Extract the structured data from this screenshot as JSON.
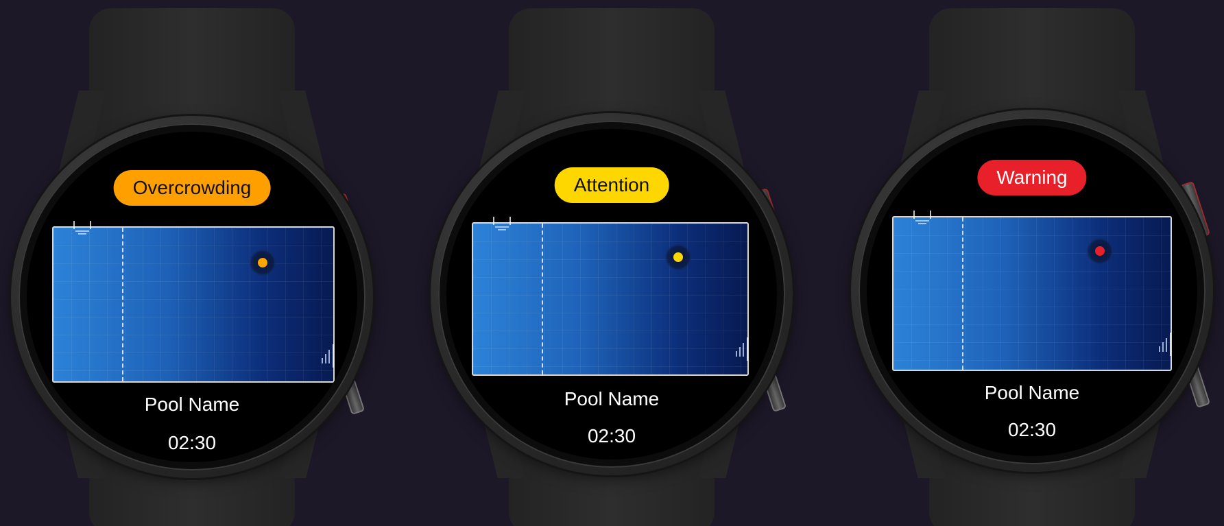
{
  "watches": [
    {
      "status_label": "Overcrowding",
      "status_color": "#ff9f00",
      "status_text_color": "#111111",
      "marker_color": "#ffa500",
      "pool_name": "Pool Name",
      "time": "02:30"
    },
    {
      "status_label": "Attention",
      "status_color": "#ffd700",
      "status_text_color": "#111111",
      "marker_color": "#ffd700",
      "pool_name": "Pool Name",
      "time": "02:30"
    },
    {
      "status_label": "Warning",
      "status_color": "#e8202a",
      "status_text_color": "#ffffff",
      "marker_color": "#e8202a",
      "pool_name": "Pool Name",
      "time": "02:30"
    }
  ],
  "icons": {
    "ladder": "pool-ladder-icon",
    "steps": "pool-steps-icon",
    "marker": "swimmer-location-icon"
  }
}
